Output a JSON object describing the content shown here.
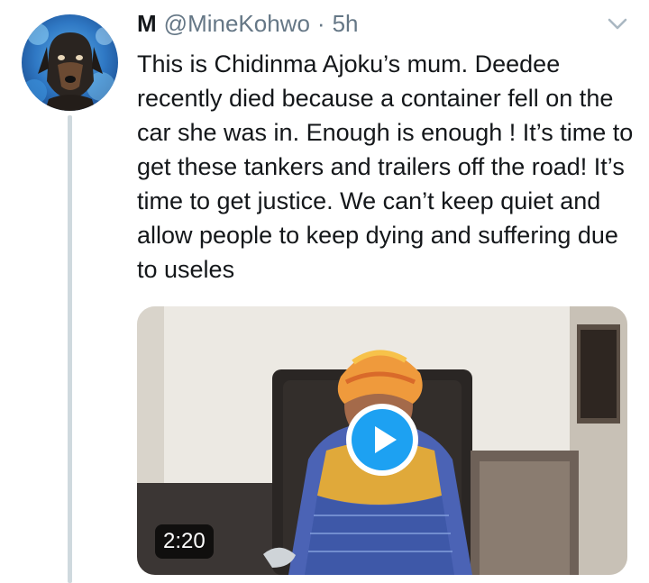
{
  "tweet": {
    "display_name": "M",
    "handle": "@MineKohwo",
    "separator": "·",
    "timestamp": "5h",
    "text": "This is Chidinma Ajoku’s mum. Deedee recently died because a container fell on the car she was in. Enough is enough ! It’s time to get these tankers and trailers off the road! It’s time to get justice. We can’t keep quiet and allow people to keep dying and suffering due to useles",
    "avatar_icon": "dog-avatar-icon",
    "menu_icon": "chevron-down-icon"
  },
  "media": {
    "type": "video",
    "duration": "2:20",
    "play_icon": "play-icon"
  },
  "colors": {
    "accent": "#1da1f2",
    "text": "#14171a",
    "secondary_text": "#657786",
    "thread_line": "#cfd9de"
  }
}
